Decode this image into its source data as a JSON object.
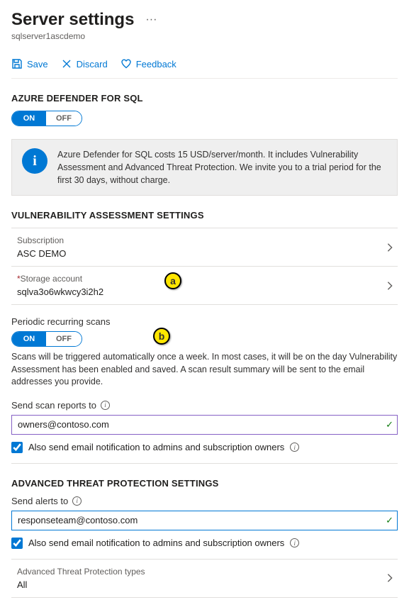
{
  "header": {
    "title": "Server settings",
    "subtitle": "sqlserver1ascdemo"
  },
  "toolbar": {
    "save": "Save",
    "discard": "Discard",
    "feedback": "Feedback"
  },
  "defenderSection": {
    "heading": "AZURE DEFENDER FOR SQL",
    "toggleOn": "ON",
    "toggleOff": "OFF",
    "infoText": "Azure Defender for SQL costs 15 USD/server/month. It includes Vulnerability Assessment and Advanced Threat Protection. We invite you to a trial period for the first 30 days, without charge."
  },
  "vulnerability": {
    "heading": "VULNERABILITY ASSESSMENT SETTINGS",
    "subscriptionLabel": "Subscription",
    "subscriptionValue": "ASC DEMO",
    "storageLabel": "Storage account",
    "storageValue": "sqlva3o6wkwcy3i2h2",
    "periodicLabel": "Periodic recurring scans",
    "periodicOn": "ON",
    "periodicOff": "OFF",
    "periodicDesc": "Scans will be triggered automatically once a week. In most cases, it will be on the day Vulnerability Assessment has been enabled and saved. A scan result summary will be sent to the email addresses you provide.",
    "sendReportsLabel": "Send scan reports to",
    "sendReportsValue": "owners@contoso.com",
    "alsoNotify": "Also send email notification to admins and subscription owners"
  },
  "atp": {
    "heading": "ADVANCED THREAT PROTECTION SETTINGS",
    "sendAlertsLabel": "Send alerts to",
    "sendAlertsValue": "responseteam@contoso.com",
    "alsoNotify": "Also send email notification to admins and subscription owners",
    "typesLabel": "Advanced Threat Protection types",
    "typesValue": "All"
  },
  "annotations": {
    "a": "a",
    "b": "b"
  }
}
